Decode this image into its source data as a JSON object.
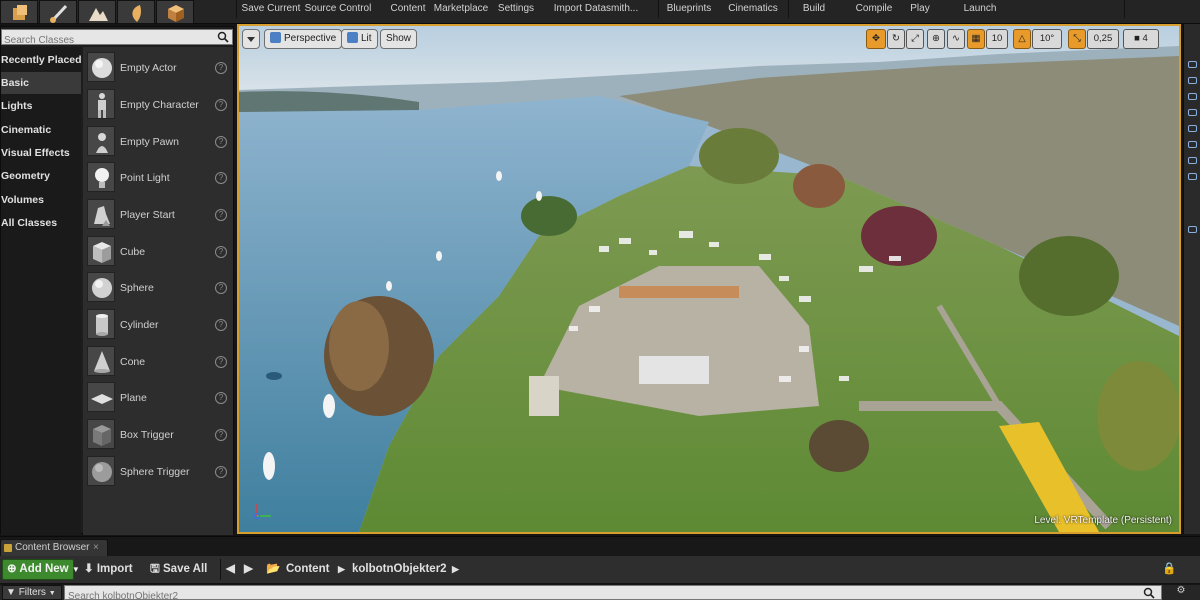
{
  "toolbar": {
    "items": [
      {
        "label": "Save Current",
        "icon": "save-icon"
      },
      {
        "label": "Source Control",
        "icon": "source-control-icon"
      },
      {
        "label": "Content",
        "icon": "content-icon"
      },
      {
        "label": "Marketplace",
        "icon": "marketplace-icon"
      },
      {
        "label": "Settings",
        "icon": "settings-icon"
      },
      {
        "label": "Import Datasmith...",
        "icon": "datasmith-icon"
      },
      {
        "label": "Blueprints",
        "icon": "blueprints-icon"
      },
      {
        "label": "Cinematics",
        "icon": "cinematics-icon"
      },
      {
        "label": "Build",
        "icon": "build-icon"
      },
      {
        "label": "Compile",
        "icon": "compile-icon"
      },
      {
        "label": "Play",
        "icon": "play-icon"
      },
      {
        "label": "Launch",
        "icon": "launch-icon"
      }
    ],
    "mode_icons": [
      "place-mode-icon",
      "paint-mode-icon",
      "landscape-mode-icon",
      "foliage-mode-icon",
      "geometry-mode-icon"
    ]
  },
  "modes": {
    "search_placeholder": "Search Classes",
    "categories": [
      {
        "label": "Recently Placed",
        "active": false
      },
      {
        "label": "Basic",
        "active": true
      },
      {
        "label": "Lights",
        "active": false
      },
      {
        "label": "Cinematic",
        "active": false
      },
      {
        "label": "Visual Effects",
        "active": false
      },
      {
        "label": "Geometry",
        "active": false
      },
      {
        "label": "Volumes",
        "active": false
      },
      {
        "label": "All Classes",
        "active": false
      }
    ],
    "placeables": [
      {
        "label": "Empty Actor",
        "icon": "sphere-icon"
      },
      {
        "label": "Empty Character",
        "icon": "character-icon"
      },
      {
        "label": "Empty Pawn",
        "icon": "pawn-icon"
      },
      {
        "label": "Point Light",
        "icon": "point-light-icon"
      },
      {
        "label": "Player Start",
        "icon": "player-start-icon"
      },
      {
        "label": "Cube",
        "icon": "cube-icon"
      },
      {
        "label": "Sphere",
        "icon": "sphere-icon"
      },
      {
        "label": "Cylinder",
        "icon": "cylinder-icon"
      },
      {
        "label": "Cone",
        "icon": "cone-icon"
      },
      {
        "label": "Plane",
        "icon": "plane-icon"
      },
      {
        "label": "Box Trigger",
        "icon": "box-trigger-icon"
      },
      {
        "label": "Sphere Trigger",
        "icon": "sphere-trigger-icon"
      }
    ],
    "help_glyph": "?"
  },
  "viewport": {
    "view_mode": "Perspective",
    "lighting": "Lit",
    "show": "Show",
    "grid_snap": "10",
    "rotation_snap": "10°",
    "scale_snap": "0,25",
    "camera_speed": "4",
    "level_label": "Level:  VRTemplate (Persistent)"
  },
  "content_browser": {
    "tab_label": "Content Browser",
    "add_new": "Add New",
    "import": "Import",
    "save_all": "Save All",
    "path": [
      "Content",
      "kolbotnObjekter2"
    ],
    "filters": "Filters",
    "search_placeholder": "Search kolbotnObjekter2"
  },
  "colors": {
    "viewport_border": "#d79e2e",
    "add_new_green": "#3d8a2e",
    "panel_dark": "#1d1d1d"
  }
}
